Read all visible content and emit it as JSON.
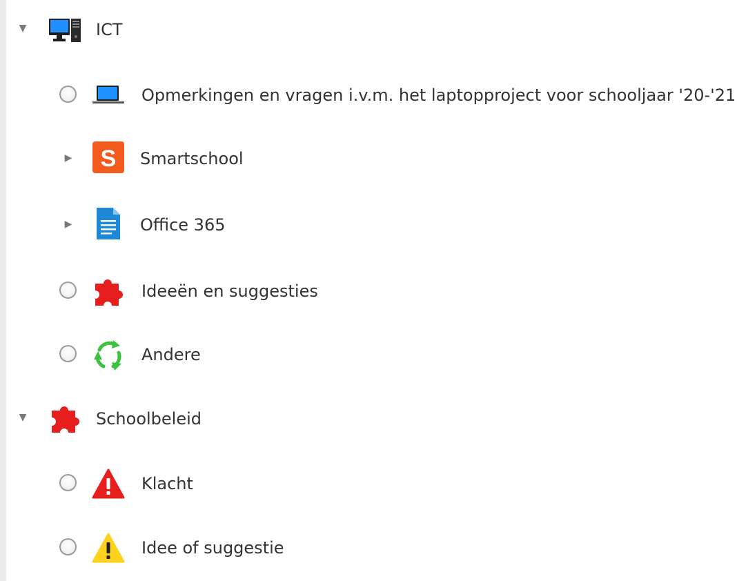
{
  "tree": {
    "ict": {
      "label": "ICT",
      "icon": "desktop-computer-icon",
      "expanded": true,
      "children": [
        {
          "label": "Opmerkingen en vragen i.v.m. het laptopproject voor schooljaar '20-'21",
          "icon": "laptop-icon"
        },
        {
          "label": "Smartschool",
          "icon": "smartschool-logo-icon"
        },
        {
          "label": "Office 365",
          "icon": "document-icon"
        },
        {
          "label": "Ideeën en suggesties",
          "icon": "puzzle-piece-icon"
        },
        {
          "label": "Andere",
          "icon": "recycle-arrows-icon"
        }
      ]
    },
    "schoolbeleid": {
      "label": "Schoolbeleid",
      "icon": "puzzle-piece-icon",
      "expanded": true,
      "children": [
        {
          "label": "Klacht",
          "icon": "warning-red-icon"
        },
        {
          "label": "Idee of suggestie",
          "icon": "warning-yellow-icon"
        }
      ]
    }
  },
  "colors": {
    "toggle": "#7a7a7a",
    "text": "#333333",
    "smartschool": "#f25a1e",
    "office_doc": "#1e88d8",
    "puzzle": "#e61e1e",
    "recycle": "#3cc23c",
    "warning_red": "#e61e1e",
    "warning_yellow": "#ffd21e"
  }
}
